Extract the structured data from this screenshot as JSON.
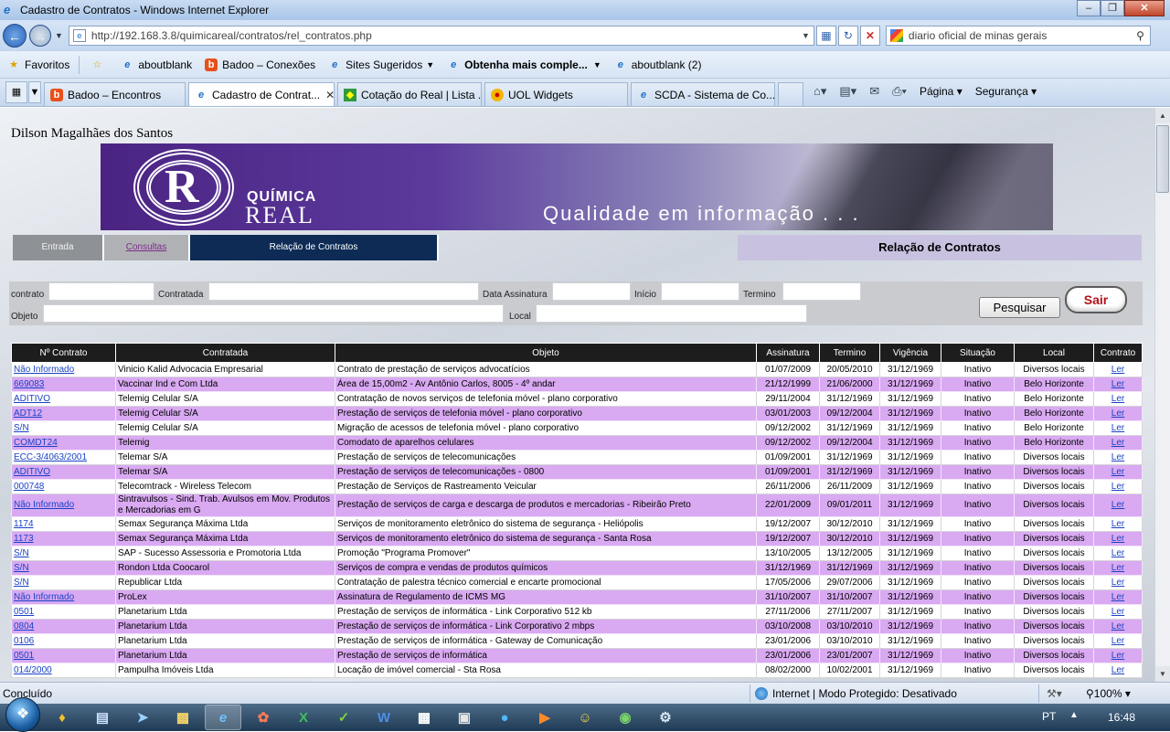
{
  "window": {
    "title": "Cadastro de Contratos - Windows Internet Explorer"
  },
  "address": {
    "url": "http://192.168.3.8/quimicareal/contratos/rel_contratos.php",
    "search_text": "diario oficial de minas gerais"
  },
  "favorites": {
    "label": "Favoritos",
    "items": [
      "aboutblank",
      "Badoo – Conexões",
      "Sites Sugeridos",
      "Obtenha mais comple...",
      "aboutblank (2)"
    ]
  },
  "tabs": [
    {
      "label": "Badoo – Encontros"
    },
    {
      "label": "Cadastro de Contrat..."
    },
    {
      "label": "Cotação do Real | Lista ..."
    },
    {
      "label": "UOL Widgets"
    },
    {
      "label": "SCDA - Sistema de Co..."
    }
  ],
  "commands": {
    "page": "Página",
    "security": "Segurança"
  },
  "page": {
    "user_name": "Dilson Magalhães dos Santos",
    "banner": {
      "brand_top": "QUÍMICA",
      "brand_bottom": "REAL",
      "tagline": "Qualidade em informação . . ."
    },
    "menu": {
      "entrada": "Entrada",
      "consultas": "Consultas",
      "relacao": "Relação de Contratos"
    },
    "heading": "Relação de Contratos",
    "filters": {
      "contrato": "contrato",
      "contratada": "Contratada",
      "data_assinatura": "Data Assinatura",
      "inicio": "Início",
      "termino": "Termino",
      "objeto": "Objeto",
      "local": "Local"
    },
    "buttons": {
      "pesquisar": "Pesquisar",
      "sair": "Sair"
    }
  },
  "table": {
    "headers": [
      "Nº Contrato",
      "Contratada",
      "Objeto",
      "Assinatura",
      "Termino",
      "Vigência",
      "Situação",
      "Local",
      "Contrato"
    ],
    "rows": [
      [
        "Não Informado",
        "Vinicio Kalid Advocacia Empresarial",
        "Contrato de prestação de serviços advocatícios",
        "01/07/2009",
        "20/05/2010",
        "31/12/1969",
        "Inativo",
        "Diversos locais",
        "Ler"
      ],
      [
        "669083",
        "Vaccinar Ind e Com Ltda",
        "Área de 15,00m2 - Av Antônio Carlos, 8005 - 4º andar",
        "21/12/1999",
        "21/06/2000",
        "31/12/1969",
        "Inativo",
        "Belo Horizonte",
        "Ler"
      ],
      [
        "ADITIVO",
        "Telemig Celular S/A",
        "Contratação de novos serviços de telefonia móvel - plano corporativo",
        "29/11/2004",
        "31/12/1969",
        "31/12/1969",
        "Inativo",
        "Belo Horizonte",
        "Ler"
      ],
      [
        "ADT12",
        "Telemig Celular S/A",
        "Prestação de serviços de telefonia móvel - plano corporativo",
        "03/01/2003",
        "09/12/2004",
        "31/12/1969",
        "Inativo",
        "Belo Horizonte",
        "Ler"
      ],
      [
        "S/N",
        "Telemig Celular S/A",
        "Migração de acessos de telefonia móvel - plano corporativo",
        "09/12/2002",
        "31/12/1969",
        "31/12/1969",
        "Inativo",
        "Belo Horizonte",
        "Ler"
      ],
      [
        "COMDT24",
        "Telemig",
        "Comodato de aparelhos celulares",
        "09/12/2002",
        "09/12/2004",
        "31/12/1969",
        "Inativo",
        "Belo Horizonte",
        "Ler"
      ],
      [
        "ECC-3/4063/2001",
        "Telemar S/A",
        "Prestação de serviços de telecomunicações",
        "01/09/2001",
        "31/12/1969",
        "31/12/1969",
        "Inativo",
        "Diversos locais",
        "Ler"
      ],
      [
        "ADITIVO",
        "Telemar S/A",
        "Prestação de serviços de telecomunicações - 0800",
        "01/09/2001",
        "31/12/1969",
        "31/12/1969",
        "Inativo",
        "Diversos locais",
        "Ler"
      ],
      [
        "000748",
        "Telecomtrack - Wireless Telecom",
        "Prestação de Serviços de Rastreamento Veicular",
        "26/11/2006",
        "26/11/2009",
        "31/12/1969",
        "Inativo",
        "Diversos locais",
        "Ler"
      ],
      [
        "Não Informado",
        "Sintravulsos - Sind. Trab. Avulsos em Mov. Produtos e Mercadorias em G",
        "Prestação de serviços de carga e descarga de produtos e mercadorias - Ribeirão Preto",
        "22/01/2009",
        "09/01/2011",
        "31/12/1969",
        "Inativo",
        "Diversos locais",
        "Ler"
      ],
      [
        "1174",
        "Semax Segurança Máxima Ltda",
        "Serviços de monitoramento eletrônico do sistema de segurança - Heliópolis",
        "19/12/2007",
        "30/12/2010",
        "31/12/1969",
        "Inativo",
        "Diversos locais",
        "Ler"
      ],
      [
        "1173",
        "Semax Segurança Máxima Ltda",
        "Serviços de monitoramento eletrônico do sistema de segurança - Santa Rosa",
        "19/12/2007",
        "30/12/2010",
        "31/12/1969",
        "Inativo",
        "Diversos locais",
        "Ler"
      ],
      [
        "S/N",
        "SAP - Sucesso Assessoria e Promotoria Ltda",
        "Promoção \"Programa Promover\"",
        "13/10/2005",
        "13/12/2005",
        "31/12/1969",
        "Inativo",
        "Diversos locais",
        "Ler"
      ],
      [
        "S/N",
        "Rondon Ltda Coocarol",
        "Serviços de compra e vendas de produtos químicos",
        "31/12/1969",
        "31/12/1969",
        "31/12/1969",
        "Inativo",
        "Diversos locais",
        "Ler"
      ],
      [
        "S/N",
        "Republicar Ltda",
        "Contratação de palestra técnico comercial e encarte promocional",
        "17/05/2006",
        "29/07/2006",
        "31/12/1969",
        "Inativo",
        "Diversos locais",
        "Ler"
      ],
      [
        "Não Informado",
        "ProLex",
        "Assinatura de Regulamento de ICMS MG",
        "31/10/2007",
        "31/10/2007",
        "31/12/1969",
        "Inativo",
        "Diversos locais",
        "Ler"
      ],
      [
        "0501",
        "Planetarium Ltda",
        "Prestação de serviços de informática - Link Corporativo 512 kb",
        "27/11/2006",
        "27/11/2007",
        "31/12/1969",
        "Inativo",
        "Diversos locais",
        "Ler"
      ],
      [
        "0804",
        "Planetarium Ltda",
        "Prestação de serviços de informática - Link Corporativo 2 mbps",
        "03/10/2008",
        "03/10/2010",
        "31/12/1969",
        "Inativo",
        "Diversos locais",
        "Ler"
      ],
      [
        "0106",
        "Planetarium Ltda",
        "Prestação de serviços de informática - Gateway de Comunicação",
        "23/01/2006",
        "03/10/2010",
        "31/12/1969",
        "Inativo",
        "Diversos locais",
        "Ler"
      ],
      [
        "0501",
        "Planetarium Ltda",
        "Prestação de serviços de informática",
        "23/01/2006",
        "23/01/2007",
        "31/12/1969",
        "Inativo",
        "Diversos locais",
        "Ler"
      ],
      [
        "014/2000",
        "Pampulha Imóveis Ltda",
        "Locação de imóvel comercial - Sta Rosa",
        "08/02/2000",
        "10/02/2001",
        "31/12/1969",
        "Inativo",
        "Diversos locais",
        "Ler"
      ]
    ]
  },
  "status": {
    "text": "Concluído",
    "zone": "Internet | Modo Protegido: Desativado",
    "zoom": "100%"
  },
  "taskbar": {
    "lang": "PT",
    "clock": "16:48"
  }
}
